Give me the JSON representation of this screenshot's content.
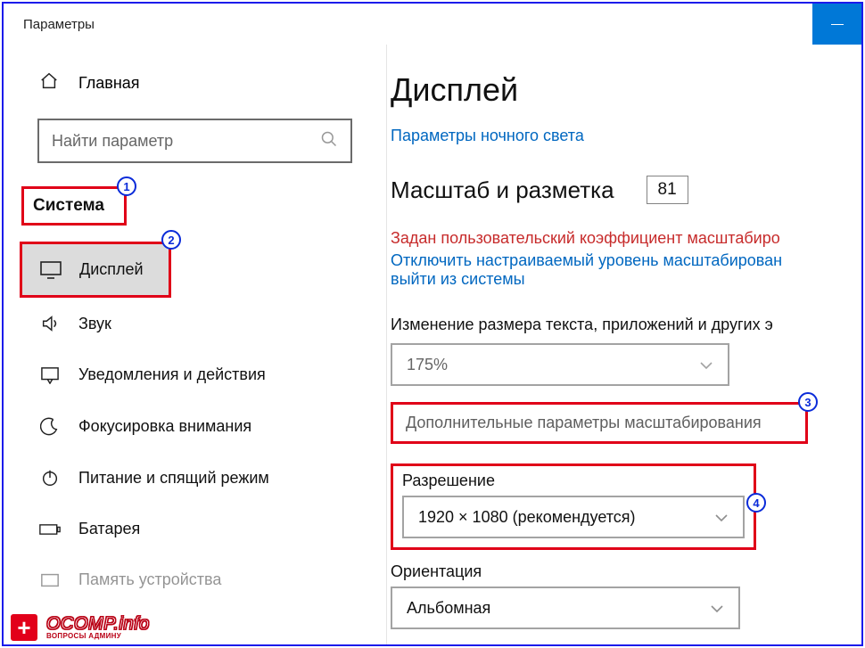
{
  "window": {
    "title": "Параметры"
  },
  "sidebar": {
    "home": "Главная",
    "search_placeholder": "Найти параметр",
    "category": "Система",
    "items": [
      {
        "label": "Дисплей"
      },
      {
        "label": "Звук"
      },
      {
        "label": "Уведомления и действия"
      },
      {
        "label": "Фокусировка внимания"
      },
      {
        "label": "Питание и спящий режим"
      },
      {
        "label": "Батарея"
      },
      {
        "label": "Память устройства"
      }
    ]
  },
  "content": {
    "title": "Дисплей",
    "night_light_link": "Параметры ночного света",
    "scale_header": "Масштаб и разметка",
    "scale_value_badge": "81",
    "warning": "Задан пользовательский коэффициент масштабиро",
    "disable_link": "Отключить настраиваемый уровень масштабирован",
    "logout_link": "выйти из системы",
    "resize_label": "Изменение размера текста, приложений и других э",
    "scale_selected": "175%",
    "advanced_scaling": "Дополнительные параметры масштабирования",
    "resolution_label": "Разрешение",
    "resolution_value": "1920 × 1080 (рекомендуется)",
    "orientation_label": "Ориентация",
    "orientation_value": "Альбомная"
  },
  "badges": {
    "b1": "1",
    "b2": "2",
    "b3": "3",
    "b4": "4"
  },
  "logo": {
    "main": "OCOMP.info",
    "sub": "ВОПРОСЫ АДМИНУ"
  }
}
